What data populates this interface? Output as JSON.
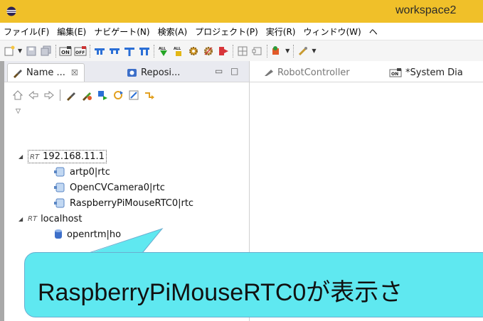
{
  "window": {
    "title": "workspace2"
  },
  "menu": {
    "items": [
      "ファイル(F)",
      "編集(E)",
      "ナビゲート(N)",
      "検索(A)",
      "プロジェクト(P)",
      "実行(R)",
      "ウィンドウ(W)",
      "ヘ"
    ]
  },
  "toolbar": {
    "icons": [
      "new-icon",
      "save-icon",
      "save-all-icon",
      "on-icon",
      "off-icon",
      "connect-icon",
      "disconnect-icon",
      "all-connect-icon",
      "all-disconnect-icon",
      "all-activate-icon",
      "all-deactivate-icon",
      "gear-icon",
      "gear-stop-icon",
      "exit-icon",
      "layout-icon",
      "layout2-icon",
      "run-icon",
      "tool-icon"
    ]
  },
  "left_panel": {
    "tab_active_label": "Name ...",
    "tab_active_close": "☒",
    "tab_second_label": "Reposi...",
    "minimize": "▭",
    "maximize": "□"
  },
  "tree": {
    "nodes": [
      {
        "prefix": "RT",
        "label": "192.168.11.1"
      },
      {
        "label": "artp0|rtc"
      },
      {
        "label": "OpenCVCamera0|rtc"
      },
      {
        "label": "RaspberryPiMouseRTC0|rtc"
      },
      {
        "prefix": "RT",
        "label": "localhost"
      },
      {
        "label": "openrtm|ho"
      }
    ]
  },
  "editor_tabs": {
    "tab1": "RobotController",
    "tab2": "*System Dia"
  },
  "callout": {
    "text": "RaspberryPiMouseRTC0が表示さ"
  },
  "colors": {
    "titlebar": "#f0c029",
    "callout_fill": "#5fe8f0",
    "callout_border": "#6aaed0"
  }
}
